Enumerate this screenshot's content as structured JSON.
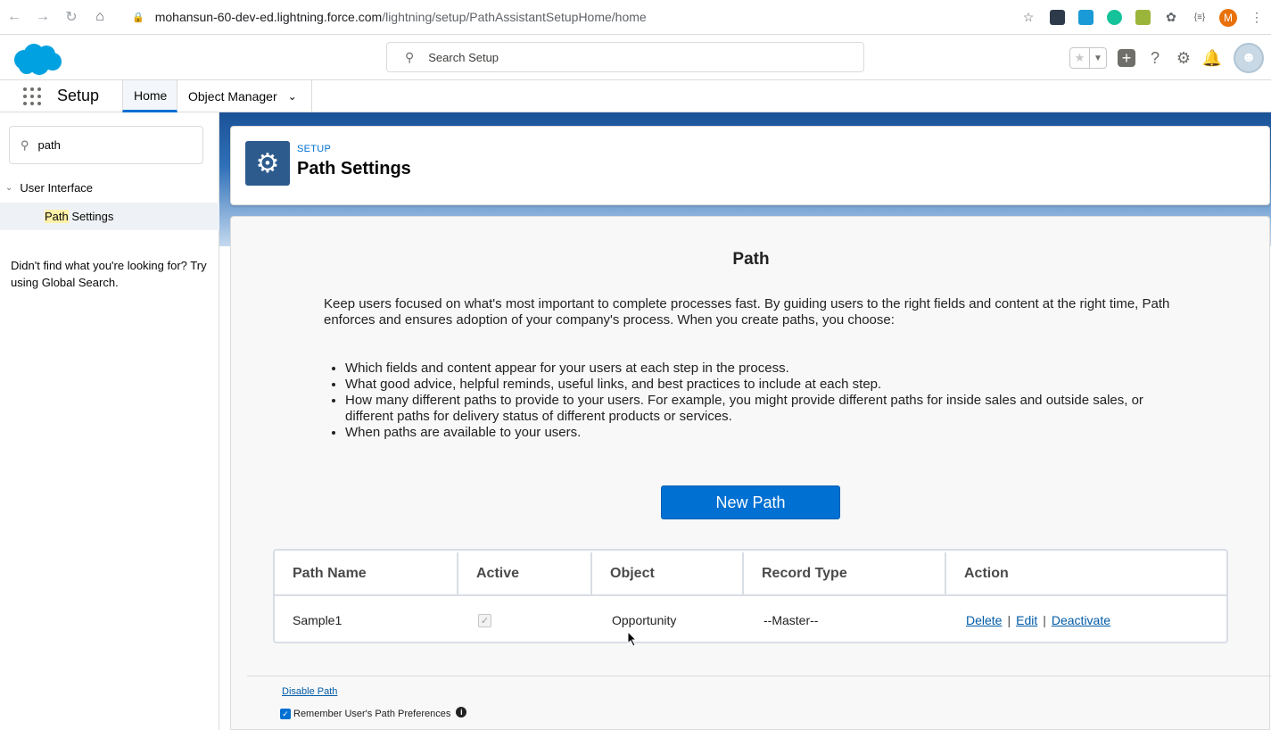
{
  "browser": {
    "url_host": "mohansun-60-dev-ed.lightning.force.com",
    "url_path": "/lightning/setup/PathAssistantSetupHome/home",
    "profile_initial": "M"
  },
  "header": {
    "search_placeholder": "Search Setup"
  },
  "app_nav": {
    "app_name": "Setup",
    "tabs": [
      {
        "label": "Home"
      },
      {
        "label": "Object Manager"
      }
    ]
  },
  "sidebar": {
    "quick_find_value": "path",
    "group_label": "User Interface",
    "item_highlight": "Path",
    "item_rest": " Settings",
    "help_text": "Didn't find what you're looking for? Try using Global Search."
  },
  "page_header": {
    "eyebrow": "SETUP",
    "title": "Path Settings"
  },
  "main": {
    "heading": "Path",
    "intro": "Keep users focused on what's most important to complete processes fast. By guiding users to the right fields and content at the right time, Path enforces and ensures adoption of your company's process. When you create paths, you choose:",
    "bullets": [
      "Which fields and content appear for your users at each step in the process.",
      "What good advice, helpful reminds, useful links, and best practices to include at each step.",
      "How many different paths to provide to your users. For example, you might provide different paths for inside sales and outside sales, or different paths for delivery status of different products or services.",
      "When paths are available to your users."
    ],
    "new_path_label": "New Path",
    "table": {
      "columns": [
        "Path Name",
        "Active",
        "Object",
        "Record Type",
        "Action"
      ],
      "rows": [
        {
          "path_name": "Sample1",
          "active": true,
          "object": "Opportunity",
          "record_type": "--Master--",
          "actions": [
            "Delete",
            "Edit",
            "Deactivate"
          ]
        }
      ]
    },
    "disable_link": "Disable Path",
    "remember_label": "Remember User's Path Preferences",
    "remember_checked": true
  },
  "colors": {
    "brand": "#0070d2",
    "setup_icon_bg": "#2d5b8d",
    "link": "#015ba7"
  }
}
